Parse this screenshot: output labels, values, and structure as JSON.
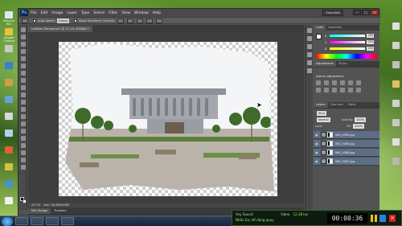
{
  "desktop": {
    "left_icons": [
      {
        "label": "Recycle Bin",
        "color": "#dfe8f0"
      },
      {
        "label": "Google Chrome",
        "color": "#e8c238"
      },
      {
        "label": "",
        "color": "#c9c9c9"
      },
      {
        "label": "",
        "color": "#3a7fd0"
      },
      {
        "label": "",
        "color": "#d0a040"
      },
      {
        "label": "",
        "color": "#6aa0d8"
      },
      {
        "label": "",
        "color": "#d8d8d8"
      },
      {
        "label": "",
        "color": "#b0d0f0"
      },
      {
        "label": "",
        "color": "#e06030"
      },
      {
        "label": "",
        "color": "#d8c040"
      },
      {
        "label": "",
        "color": "#4a90d0"
      },
      {
        "label": "",
        "color": "#f0f0f0"
      }
    ],
    "right_icons": [
      {
        "label": "",
        "color": "#e0e0e0"
      },
      {
        "label": "",
        "color": "#d0d0d0"
      },
      {
        "label": "",
        "color": "#c0c0c0"
      },
      {
        "label": "",
        "color": "#e0c060"
      },
      {
        "label": "",
        "color": "#d0d0d0"
      },
      {
        "label": "",
        "color": "#c8c8c8"
      },
      {
        "label": "",
        "color": "#e0e0e0"
      },
      {
        "label": "",
        "color": "#b8b8b8"
      }
    ]
  },
  "photoshop": {
    "menu": [
      "File",
      "Edit",
      "Image",
      "Layer",
      "Type",
      "Select",
      "Filter",
      "View",
      "Window",
      "Help"
    ],
    "workspace": "Essentials",
    "window_controls": {
      "minimize": "–",
      "maximize": "□",
      "close": "×"
    },
    "options": {
      "auto_select_label": "Auto-Select:",
      "auto_select_value": "Group",
      "show_transform_label": "Show Transform Controls"
    },
    "document_tab": "Untitled_Panorama1 @ 25.1% (RGB/8) *",
    "status": {
      "zoom": "25.1%",
      "doc": "Doc: 54.6M/549M"
    },
    "bottom_tabs": [
      "Mini Bridge",
      "Timeline"
    ],
    "panels": {
      "color_tabs": [
        "Color",
        "Swatches"
      ],
      "sliders": [
        {
          "label": "R",
          "value": "255",
          "gradient": "linear-gradient(90deg,#00ffff,#ffffff)"
        },
        {
          "label": "G",
          "value": "255",
          "gradient": "linear-gradient(90deg,#ff00ff,#ffffff)"
        },
        {
          "label": "B",
          "value": "255",
          "gradient": "linear-gradient(90deg,#ffff00,#ffffff)"
        }
      ],
      "adj_tabs": [
        "Adjustments",
        "Styles"
      ],
      "adj_title": "Add an adjustment",
      "layers_tabs": [
        "Layers",
        "Channels",
        "Paths"
      ],
      "kind_label": "Kind",
      "blend_mode": "Normal",
      "opacity_label": "Opacity:",
      "opacity_value": "100%",
      "lock_label": "Lock:",
      "fill_label": "Fill:",
      "fill_value": "100%",
      "layers": [
        {
          "name": "IMG_0390.jpg"
        },
        {
          "name": "IMG_0389.jpg"
        },
        {
          "name": "IMG_0388.jpg"
        },
        {
          "name": "IMG_0387.jpg"
        }
      ]
    }
  },
  "recorder": {
    "any_sound_label": "Any Sound",
    "any_sound_value": "",
    "video_label": "Video",
    "video_value": "12:38 kw",
    "status": "Nhấn Esc để dừng quay",
    "timer": "00:00:36"
  },
  "colors": {
    "ps_bg": "#535353",
    "menubar": "#4a4a4a",
    "selected_layer": "#5d6e86",
    "recorder_green": "#7cff5a"
  }
}
